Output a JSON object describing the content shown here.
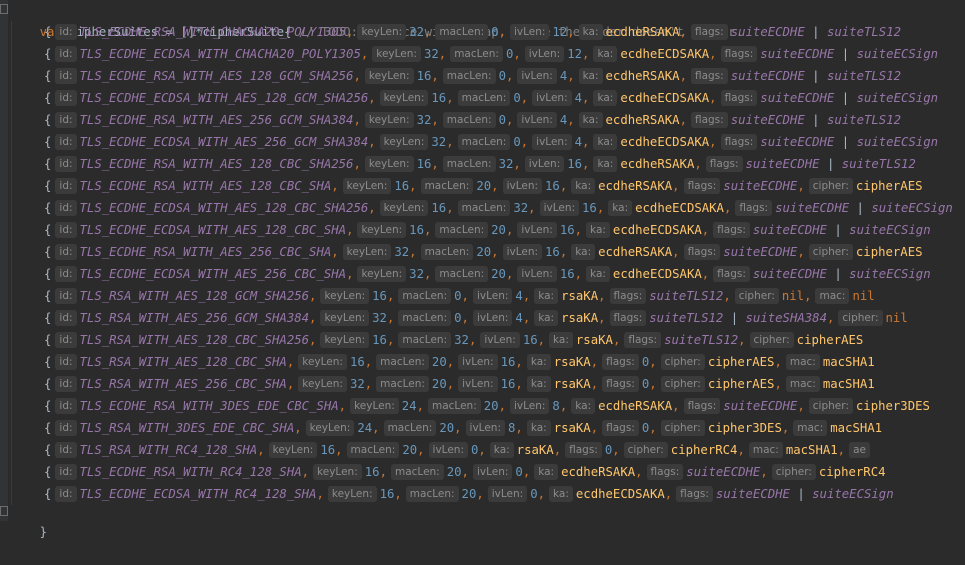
{
  "code": {
    "header": {
      "kw": "var",
      "name": "cipherSuites",
      "assign": " = ",
      "type_prefix": "[]*",
      "type": "cipherSuite",
      "brace": "{",
      "comment": "// TODO: replace with a map, since the order doesn't matter."
    },
    "hints": {
      "id": "id:",
      "keyLen": "keyLen:",
      "macLen": "macLen:",
      "ivLen": "ivLen:",
      "ka": "ka:",
      "flags": "flags:",
      "cipher": "cipher:",
      "mac": "mac:"
    },
    "rows": [
      {
        "id": "TLS_ECDHE_RSA_WITH_CHACHA20_POLY1305",
        "keyLen": "32",
        "macLen": "0",
        "ivLen": "12",
        "ka": "ecdheRSAKA",
        "flags": "suiteECDHE | suiteTLS12"
      },
      {
        "id": "TLS_ECDHE_ECDSA_WITH_CHACHA20_POLY1305",
        "keyLen": "32",
        "macLen": "0",
        "ivLen": "12",
        "ka": "ecdheECDSAKA",
        "flags": "suiteECDHE | suiteECSign"
      },
      {
        "id": "TLS_ECDHE_RSA_WITH_AES_128_GCM_SHA256",
        "keyLen": "16",
        "macLen": "0",
        "ivLen": "4",
        "ka": "ecdheRSAKA",
        "flags": "suiteECDHE | suiteTLS12"
      },
      {
        "id": "TLS_ECDHE_ECDSA_WITH_AES_128_GCM_SHA256",
        "keyLen": "16",
        "macLen": "0",
        "ivLen": "4",
        "ka": "ecdheECDSAKA",
        "flags": "suiteECDHE | suiteECSign"
      },
      {
        "id": "TLS_ECDHE_RSA_WITH_AES_256_GCM_SHA384",
        "keyLen": "32",
        "macLen": "0",
        "ivLen": "4",
        "ka": "ecdheRSAKA",
        "flags": "suiteECDHE | suiteTLS12"
      },
      {
        "id": "TLS_ECDHE_ECDSA_WITH_AES_256_GCM_SHA384",
        "keyLen": "32",
        "macLen": "0",
        "ivLen": "4",
        "ka": "ecdheECDSAKA",
        "flags": "suiteECDHE | suiteECSign"
      },
      {
        "id": "TLS_ECDHE_RSA_WITH_AES_128_CBC_SHA256",
        "keyLen": "16",
        "macLen": "32",
        "ivLen": "16",
        "ka": "ecdheRSAKA",
        "flags": "suiteECDHE | suiteTLS12"
      },
      {
        "id": "TLS_ECDHE_RSA_WITH_AES_128_CBC_SHA",
        "keyLen": "16",
        "macLen": "20",
        "ivLen": "16",
        "ka": "ecdheRSAKA",
        "flags": "suiteECDHE",
        "cipher": "cipherAES"
      },
      {
        "id": "TLS_ECDHE_ECDSA_WITH_AES_128_CBC_SHA256",
        "keyLen": "16",
        "macLen": "32",
        "ivLen": "16",
        "ka": "ecdheECDSAKA",
        "flags": "suiteECDHE | suiteECSign"
      },
      {
        "id": "TLS_ECDHE_ECDSA_WITH_AES_128_CBC_SHA",
        "keyLen": "16",
        "macLen": "20",
        "ivLen": "16",
        "ka": "ecdheECDSAKA",
        "flags": "suiteECDHE | suiteECSign"
      },
      {
        "id": "TLS_ECDHE_RSA_WITH_AES_256_CBC_SHA",
        "keyLen": "32",
        "macLen": "20",
        "ivLen": "16",
        "ka": "ecdheRSAKA",
        "flags": "suiteECDHE",
        "cipher": "cipherAES"
      },
      {
        "id": "TLS_ECDHE_ECDSA_WITH_AES_256_CBC_SHA",
        "keyLen": "32",
        "macLen": "20",
        "ivLen": "16",
        "ka": "ecdheECDSAKA",
        "flags": "suiteECDHE | suiteECSign"
      },
      {
        "id": "TLS_RSA_WITH_AES_128_GCM_SHA256",
        "keyLen": "16",
        "macLen": "0",
        "ivLen": "4",
        "ka": "rsaKA",
        "flags": "suiteTLS12",
        "cipher": "nil",
        "mac": "nil"
      },
      {
        "id": "TLS_RSA_WITH_AES_256_GCM_SHA384",
        "keyLen": "32",
        "macLen": "0",
        "ivLen": "4",
        "ka": "rsaKA",
        "flags": "suiteTLS12 | suiteSHA384",
        "cipher": "nil"
      },
      {
        "id": "TLS_RSA_WITH_AES_128_CBC_SHA256",
        "keyLen": "16",
        "macLen": "32",
        "ivLen": "16",
        "ka": "rsaKA",
        "flags": "suiteTLS12",
        "cipher": "cipherAES"
      },
      {
        "id": "TLS_RSA_WITH_AES_128_CBC_SHA",
        "keyLen": "16",
        "macLen": "20",
        "ivLen": "16",
        "ka": "rsaKA",
        "flags": "0",
        "cipher": "cipherAES",
        "mac": "macSHA1"
      },
      {
        "id": "TLS_RSA_WITH_AES_256_CBC_SHA",
        "keyLen": "32",
        "macLen": "20",
        "ivLen": "16",
        "ka": "rsaKA",
        "flags": "0",
        "cipher": "cipherAES",
        "mac": "macSHA1"
      },
      {
        "id": "TLS_ECDHE_RSA_WITH_3DES_EDE_CBC_SHA",
        "keyLen": "24",
        "macLen": "20",
        "ivLen": "8",
        "ka": "ecdheRSAKA",
        "flags": "suiteECDHE",
        "cipher": "cipher3DES"
      },
      {
        "id": "TLS_RSA_WITH_3DES_EDE_CBC_SHA",
        "keyLen": "24",
        "macLen": "20",
        "ivLen": "8",
        "ka": "rsaKA",
        "flags": "0",
        "cipher": "cipher3DES",
        "mac": "macSHA1"
      },
      {
        "id": "TLS_RSA_WITH_RC4_128_SHA",
        "keyLen": "16",
        "macLen": "20",
        "ivLen": "0",
        "ka": "rsaKA",
        "flags": "0",
        "cipher": "cipherRC4",
        "mac": "macSHA1",
        "extra": "ae"
      },
      {
        "id": "TLS_ECDHE_RSA_WITH_RC4_128_SHA",
        "keyLen": "16",
        "macLen": "20",
        "ivLen": "0",
        "ka": "ecdheRSAKA",
        "flags": "suiteECDHE",
        "cipher": "cipherRC4"
      },
      {
        "id": "TLS_ECDHE_ECDSA_WITH_RC4_128_SHA",
        "keyLen": "16",
        "macLen": "20",
        "ivLen": "0",
        "ka": "ecdheECDSAKA",
        "flags": "suiteECDHE | suiteECSign"
      }
    ],
    "footer": "}"
  }
}
